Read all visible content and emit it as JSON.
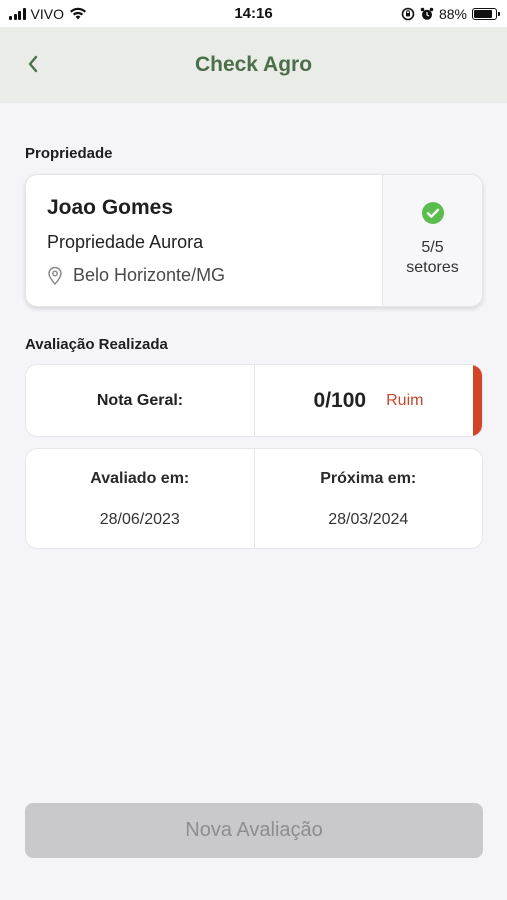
{
  "status_bar": {
    "carrier": "VIVO",
    "time": "14:16",
    "battery": "88%",
    "battery_level": 0.88,
    "icons": [
      "signal-icon",
      "wifi-icon",
      "lock-rotation-icon",
      "alarm-icon",
      "battery-icon"
    ]
  },
  "header": {
    "title": "Check Agro",
    "back_icon": "chevron-left-icon"
  },
  "property_section": {
    "label": "Propriedade",
    "owner": "Joao Gomes",
    "property_name": "Propriedade Aurora",
    "location": "Belo Horizonte/MG",
    "location_icon": "map-pin-icon",
    "sectors_count": "5/5",
    "sectors_label": "setores",
    "status_icon": "check-circle-icon"
  },
  "evaluation_section": {
    "label": "Avaliação Realizada",
    "score_label": "Nota Geral:",
    "score_value": "0/100",
    "score_rating": "Ruim",
    "evaluated_label": "Avaliado em:",
    "evaluated_date": "28/06/2023",
    "next_label": "Próxima em:",
    "next_date": "28/03/2024"
  },
  "actions": {
    "new_evaluation": "Nova Avaliação"
  },
  "colors": {
    "header_bg": "#e9ece7",
    "title_green": "#4c6e4a",
    "check_green": "#5bbd4e",
    "rating_red": "#c4482f",
    "rating_bar": "#d14526",
    "button_disabled": "#c9c9cc"
  }
}
